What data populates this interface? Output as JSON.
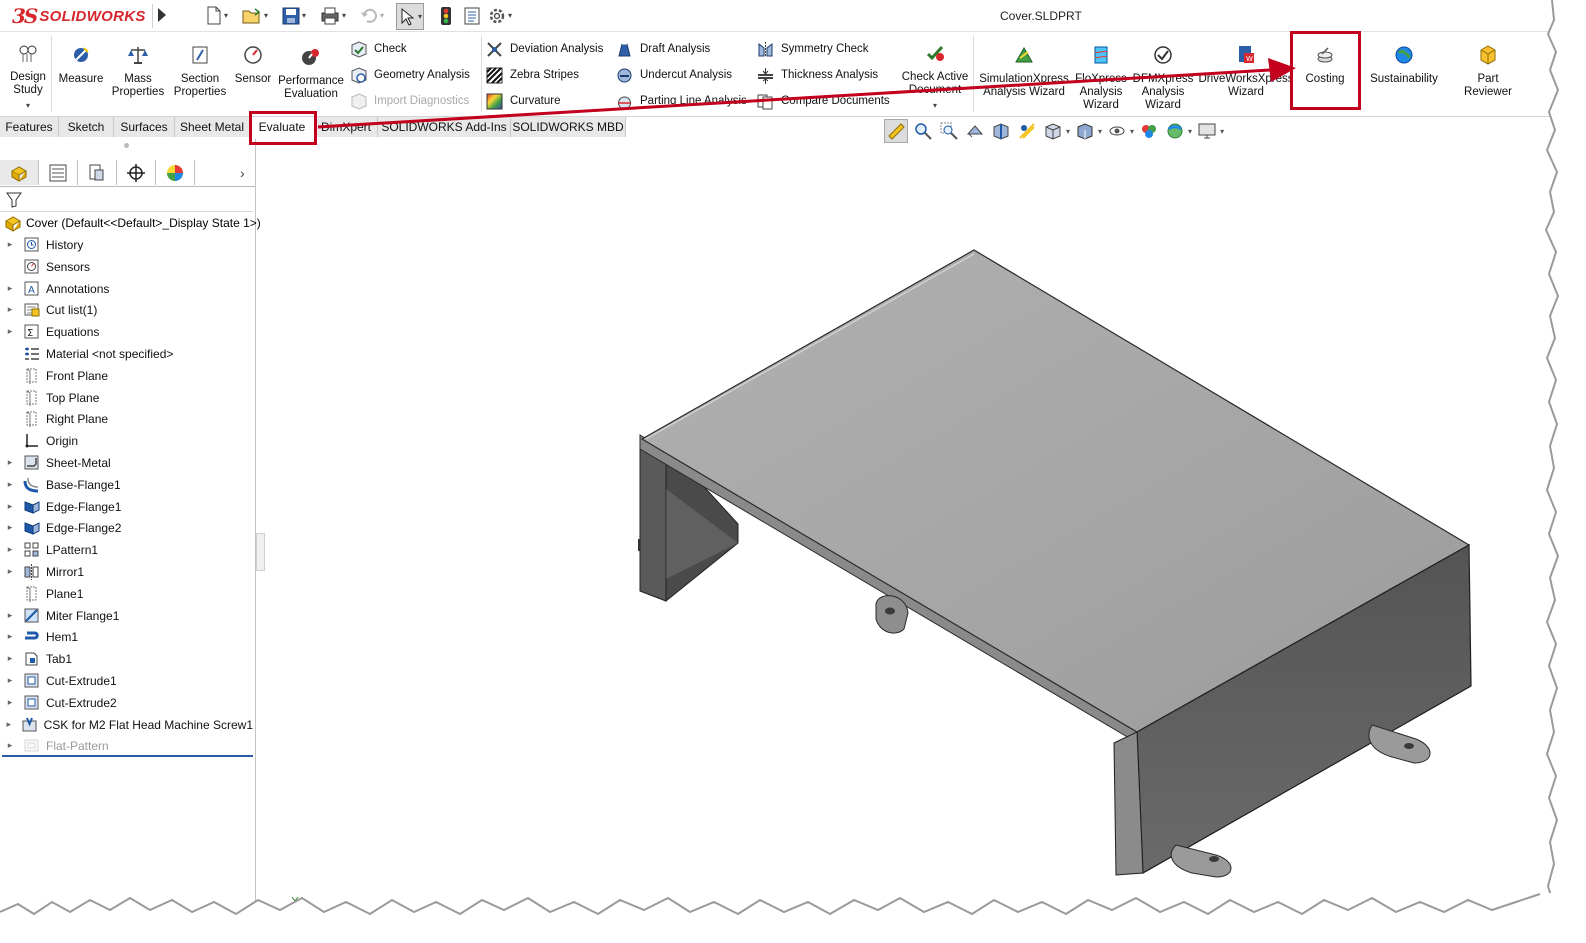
{
  "app": {
    "brand_prefix": "3S",
    "brand": "SOLIDWORKS"
  },
  "document": {
    "title": "Cover.SLDPRT"
  },
  "quick_access": {
    "icons": [
      "new-icon",
      "open-icon",
      "save-icon",
      "print-icon",
      "undo-icon",
      "select-icon",
      "traffic-light-icon",
      "file-properties-icon",
      "options-icon"
    ]
  },
  "ribbon": {
    "design_study": "Design\nStudy",
    "measure": "Measure",
    "mass_properties": "Mass\nProperties",
    "section_properties": "Section\nProperties",
    "sensor": "Sensor",
    "performance_evaluation": "Performance\nEvaluation",
    "check": "Check",
    "geometry_analysis": "Geometry Analysis",
    "import_diagnostics": "Import Diagnostics",
    "deviation_analysis": "Deviation Analysis",
    "zebra_stripes": "Zebra Stripes",
    "curvature": "Curvature",
    "draft_analysis": "Draft Analysis",
    "undercut_analysis": "Undercut Analysis",
    "parting_line_analysis": "Parting Line Analysis",
    "symmetry_check": "Symmetry Check",
    "thickness_analysis": "Thickness Analysis",
    "compare_documents": "Compare Documents",
    "check_active_document": "Check Active\nDocument",
    "simulationxpress": "SimulationXpress\nAnalysis Wizard",
    "floxpress": "FloXpress\nAnalysis\nWizard",
    "dfmxpress": "DFMXpress\nAnalysis\nWizard",
    "driveworksxpress": "DriveWorksXpress\nWizard",
    "costing": "Costing",
    "sustainability": "Sustainability",
    "part_reviewer": "Part\nReviewer"
  },
  "tabs": [
    "Features",
    "Sketch",
    "Surfaces",
    "Sheet Metal",
    "Evaluate",
    "DimXpert",
    "SOLIDWORKS Add-Ins",
    "SOLIDWORKS MBD"
  ],
  "active_tab": "Evaluate",
  "feature_tree": {
    "root": "Cover  (Default<<Default>_Display State 1>)",
    "items": [
      {
        "label": "History",
        "icon": "history-icon",
        "expandable": true
      },
      {
        "label": "Sensors",
        "icon": "sensors-icon",
        "expandable": false
      },
      {
        "label": "Annotations",
        "icon": "annotations-icon",
        "expandable": true
      },
      {
        "label": "Cut list(1)",
        "icon": "cut-list-icon",
        "expandable": true
      },
      {
        "label": "Equations",
        "icon": "equations-icon",
        "expandable": true
      },
      {
        "label": "Material <not specified>",
        "icon": "material-icon",
        "expandable": false
      },
      {
        "label": "Front Plane",
        "icon": "plane-icon",
        "expandable": false
      },
      {
        "label": "Top Plane",
        "icon": "plane-icon",
        "expandable": false
      },
      {
        "label": "Right Plane",
        "icon": "plane-icon",
        "expandable": false
      },
      {
        "label": "Origin",
        "icon": "origin-icon",
        "expandable": false
      },
      {
        "label": "Sheet-Metal",
        "icon": "sheet-metal-icon",
        "expandable": true
      },
      {
        "label": "Base-Flange1",
        "icon": "base-flange-icon",
        "expandable": true
      },
      {
        "label": "Edge-Flange1",
        "icon": "edge-flange-icon",
        "expandable": true
      },
      {
        "label": "Edge-Flange2",
        "icon": "edge-flange-icon",
        "expandable": true
      },
      {
        "label": "LPattern1",
        "icon": "linear-pattern-icon",
        "expandable": true
      },
      {
        "label": "Mirror1",
        "icon": "mirror-icon",
        "expandable": true
      },
      {
        "label": "Plane1",
        "icon": "plane-icon",
        "expandable": false
      },
      {
        "label": "Miter Flange1",
        "icon": "miter-flange-icon",
        "expandable": true
      },
      {
        "label": "Hem1",
        "icon": "hem-icon",
        "expandable": true
      },
      {
        "label": "Tab1",
        "icon": "tab-icon",
        "expandable": true
      },
      {
        "label": "Cut-Extrude1",
        "icon": "cut-extrude-icon",
        "expandable": true
      },
      {
        "label": "Cut-Extrude2",
        "icon": "cut-extrude-icon",
        "expandable": true
      },
      {
        "label": "CSK for M2 Flat Head Machine Screw1",
        "icon": "hole-wizard-icon",
        "expandable": true
      },
      {
        "label": "Flat-Pattern",
        "icon": "flat-pattern-icon",
        "expandable": true,
        "suppressed": true
      }
    ]
  },
  "colors": {
    "brand": "#d7262c",
    "highlight": "#c3001d",
    "part_top": "#a6a6a6",
    "part_side": "#5e5e5e"
  }
}
